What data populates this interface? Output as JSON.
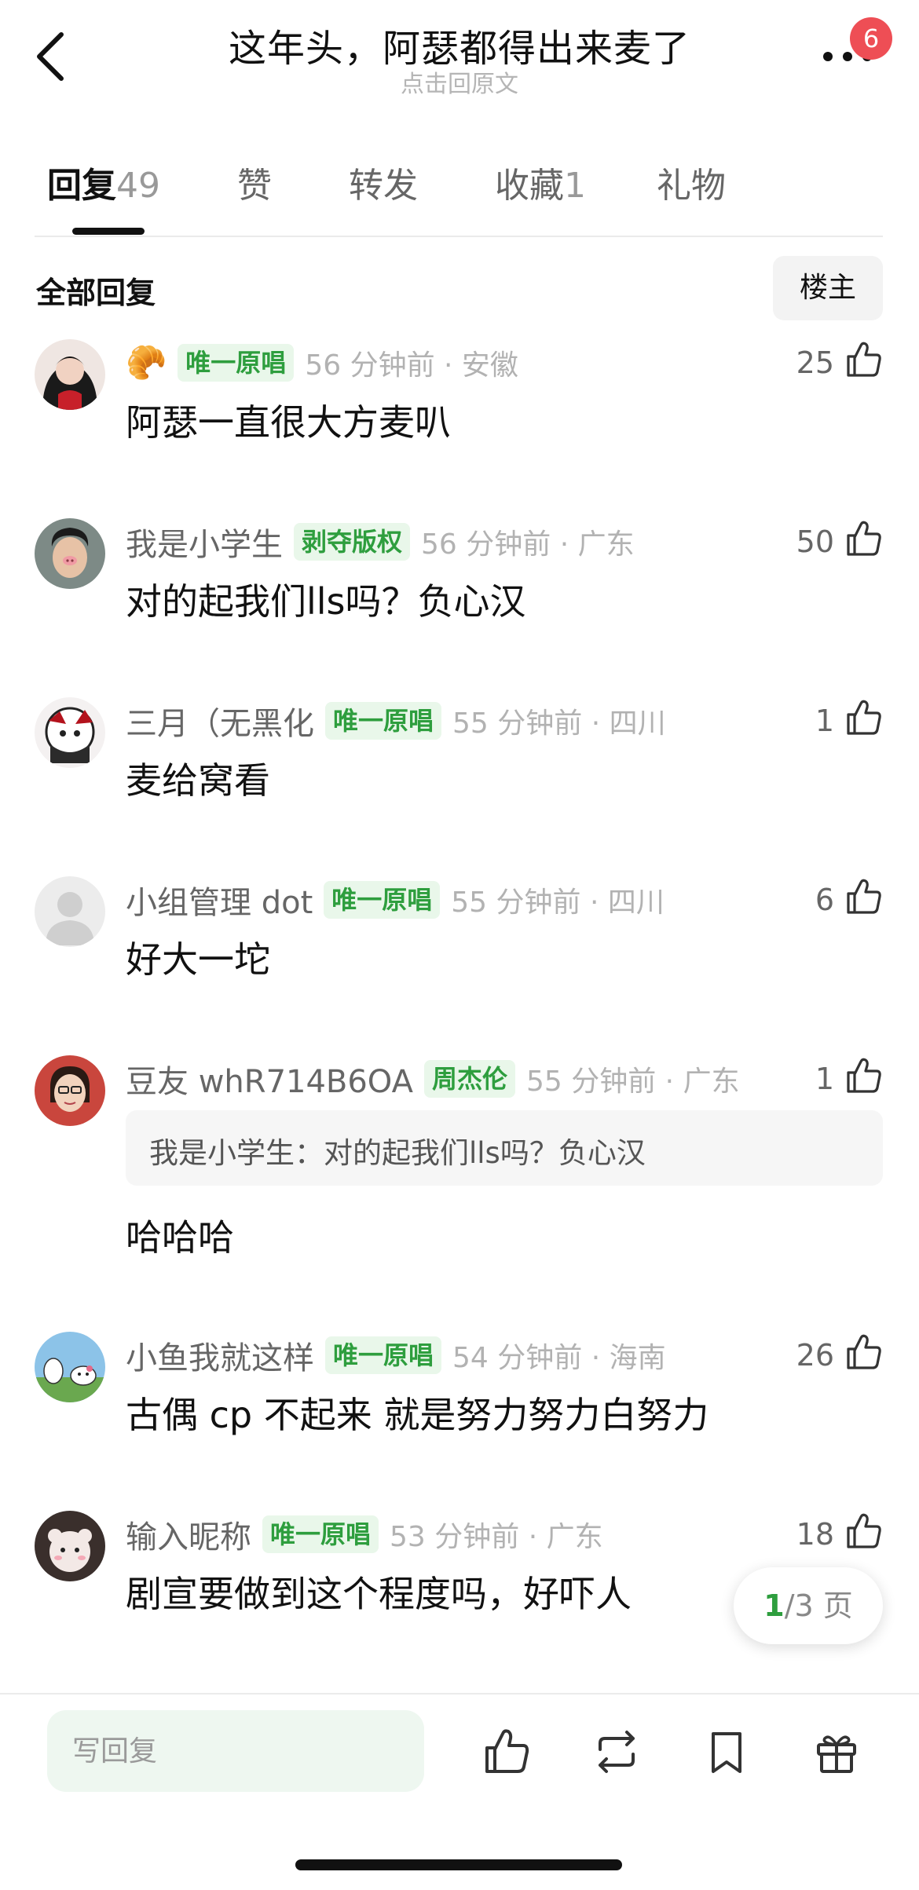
{
  "header": {
    "title": "这年头，阿瑟都得出来麦了",
    "subtitle": "点击回原文",
    "notification_count": "6"
  },
  "tabs": [
    {
      "label": "回复",
      "count": "49"
    },
    {
      "label": "赞",
      "count": ""
    },
    {
      "label": "转发",
      "count": ""
    },
    {
      "label": "收藏",
      "count": "1"
    },
    {
      "label": "礼物",
      "count": ""
    }
  ],
  "section": {
    "title": "全部回复",
    "owner_button": "楼主"
  },
  "comments": [
    {
      "username": "🥐",
      "badge": "唯一原唱",
      "time": "56 分钟前 · 安徽",
      "likes": "25",
      "content": "阿瑟一直很大方麦叭",
      "quote": ""
    },
    {
      "username": "我是小学生",
      "badge": "剥夺版权",
      "time": "56 分钟前 · 广东",
      "likes": "50",
      "content": "对的起我们lls吗？负心汉",
      "quote": ""
    },
    {
      "username": "三月（无黑化",
      "badge": "唯一原唱",
      "time": "55 分钟前 · 四川",
      "likes": "1",
      "content": "麦给窝看",
      "quote": ""
    },
    {
      "username": "小组管理 dot",
      "badge": "唯一原唱",
      "time": "55 分钟前 · 四川",
      "likes": "6",
      "content": "好大一坨",
      "quote": ""
    },
    {
      "username": "豆友 whR714B6OA",
      "badge": "周杰伦",
      "time": "55 分钟前 · 广东",
      "likes": "1",
      "content": "哈哈哈",
      "quote": "我是小学生：对的起我们lls吗？负心汉"
    },
    {
      "username": "小鱼我就这样",
      "badge": "唯一原唱",
      "time": "54 分钟前 · 海南",
      "likes": "26",
      "content": "古偶 cp 不起来 就是努力努力白努力",
      "quote": ""
    },
    {
      "username": "输入昵称",
      "badge": "唯一原唱",
      "time": "53 分钟前 · 广东",
      "likes": "18",
      "content": "剧宣要做到这个程度吗，好吓人",
      "quote": ""
    }
  ],
  "pagination": {
    "current": "1",
    "total": "/3 页"
  },
  "bottom_bar": {
    "reply_placeholder": "写回复"
  },
  "colors": {
    "accent_green": "#2e9e3e",
    "badge_bg": "#e9f7ea",
    "notification_red": "#ee4e55"
  }
}
